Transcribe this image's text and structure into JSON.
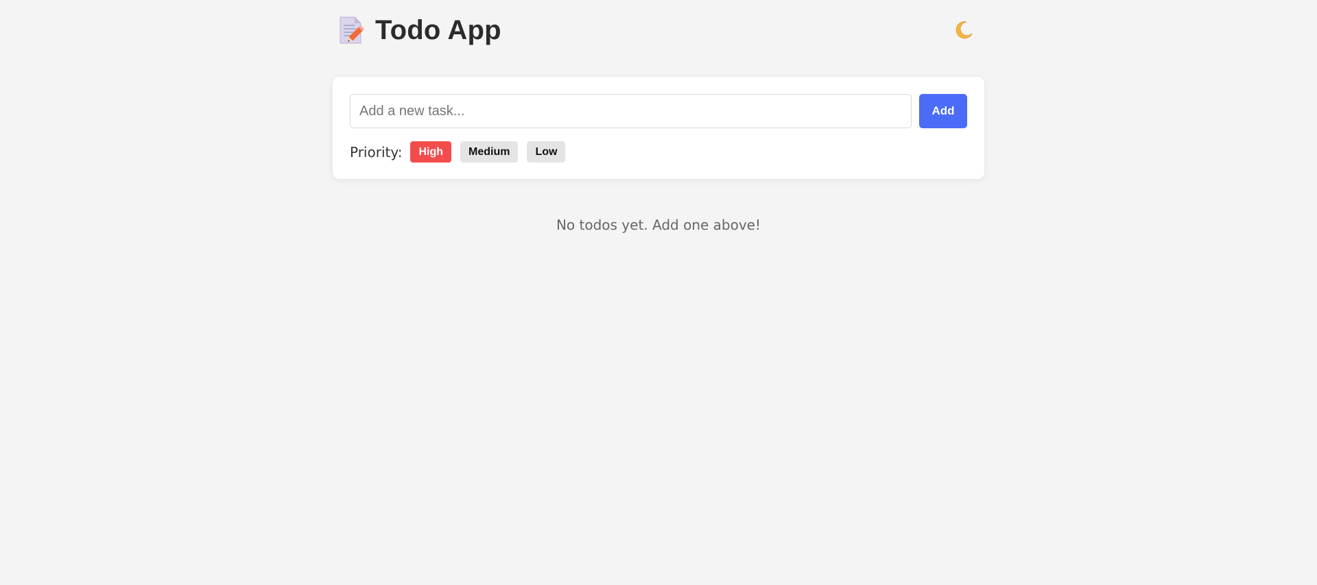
{
  "header": {
    "title": "Todo App",
    "logo_icon": "notepad-pencil-icon",
    "theme_toggle_icon": "moon-icon"
  },
  "input": {
    "placeholder": "Add a new task...",
    "value": ""
  },
  "add_button": {
    "label": "Add"
  },
  "priority": {
    "label": "Priority:",
    "options": [
      "High",
      "Medium",
      "Low"
    ],
    "selected": "High"
  },
  "empty_state": {
    "message": "No todos yet. Add one above!"
  },
  "colors": {
    "background": "#f4f4f4",
    "accent": "#4a6cf7",
    "high_priority": "#f44c4c",
    "inactive_chip": "#e4e4e4"
  }
}
